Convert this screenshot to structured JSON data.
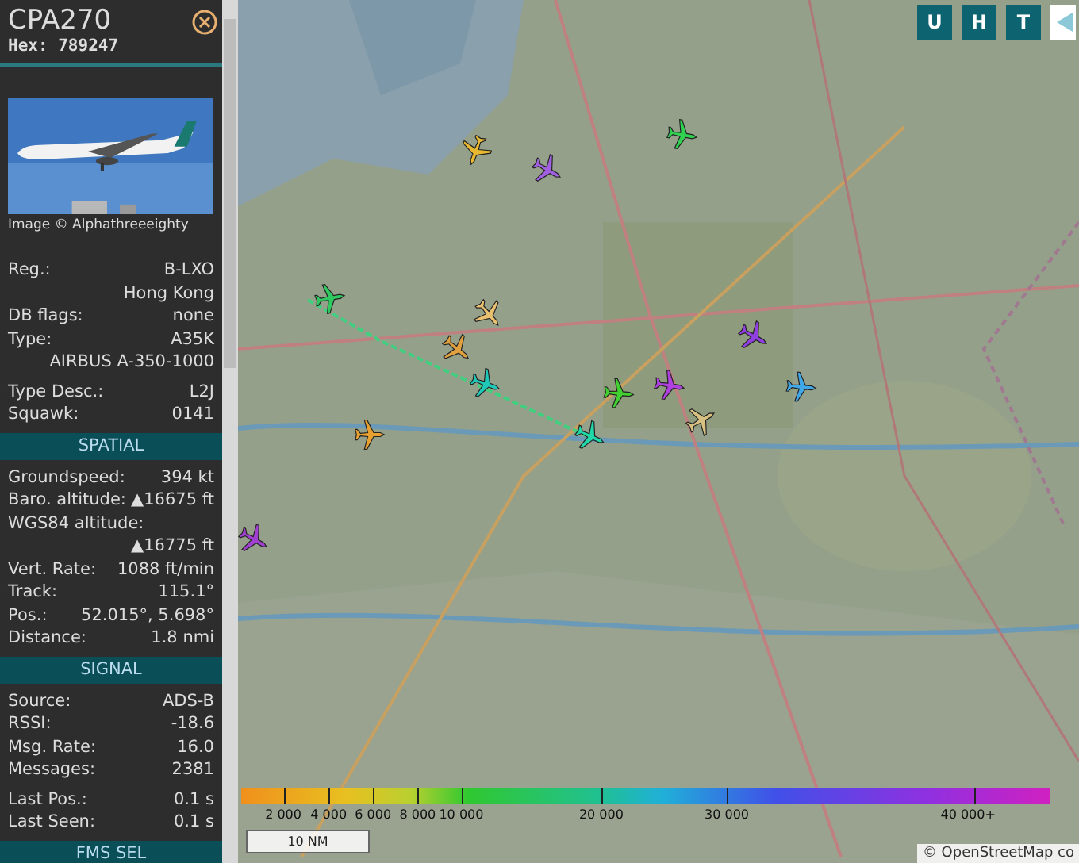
{
  "aircraft_info": {
    "callsign": "CPA270",
    "hex": "Hex: 789247",
    "photo": {
      "kind": "picture",
      "credit": "Image © Alphathreeeighty"
    },
    "groups": [
      {
        "rows": [
          {
            "label": "Reg.:",
            "value": "B-LXO"
          },
          {
            "value": "Hong Kong"
          },
          {
            "label": "DB flags:",
            "value": "none"
          },
          {
            "label": "Type:",
            "value": "A35K"
          },
          {
            "value": "AIRBUS A-350-1000"
          }
        ]
      },
      {
        "rows": [
          {
            "label": "Type Desc.:",
            "value": "L2J"
          },
          {
            "label": "Squawk:",
            "value": "0141"
          }
        ]
      },
      {
        "heading": "SPATIAL",
        "rows": [
          {
            "label": "Groundspeed:",
            "value": "394 kt"
          },
          {
            "label": "Baro. altitude:",
            "value": "▲16675 ft"
          },
          {
            "label": "WGS84 altitude:"
          },
          {
            "value": "▲16775 ft"
          },
          {
            "label": "Vert. Rate:",
            "value": "1088 ft/min"
          },
          {
            "label": "Track:",
            "value": "115.1°"
          },
          {
            "label": "Pos.:",
            "value": "52.015°, 5.698°"
          },
          {
            "label": "Distance:",
            "value": "1.8 nmi"
          }
        ]
      },
      {
        "heading": "SIGNAL",
        "rows": [
          {
            "label": "Source:",
            "value": "ADS-B"
          },
          {
            "label": "RSSI:",
            "value": "-18.6"
          },
          {
            "label": "Msg. Rate:",
            "value": "16.0"
          },
          {
            "label": "Messages:",
            "value": "2381"
          }
        ]
      },
      {
        "rows": [
          {
            "label": "Last Pos.:",
            "value": "0.1 s"
          },
          {
            "label": "Last Seen:",
            "value": "0.1 s"
          }
        ]
      },
      {
        "heading": "FMS SEL"
      }
    ]
  },
  "map": {
    "kind": "picture",
    "buttons": [
      "U",
      "H",
      "T"
    ],
    "aircraft": [
      {
        "color": "#e8b830"
      },
      {
        "color": "#a060e0"
      },
      {
        "color": "#30d050"
      },
      {
        "color": "#30c860"
      },
      {
        "color": "#e0a040"
      },
      {
        "color": "#e8c070"
      },
      {
        "color": "#20c8b8"
      },
      {
        "color": "#40d030"
      },
      {
        "color": "#b040e0"
      },
      {
        "color": "#d8c080"
      },
      {
        "color": "#9040e0"
      },
      {
        "color": "#40a8e8"
      },
      {
        "color": "#20d8a8"
      },
      {
        "color": "#e8a030"
      },
      {
        "color": "#a040d0"
      }
    ],
    "legend": [
      "2 000",
      "4 000",
      "6 000",
      "8 000",
      "10 000",
      "20 000",
      "30 000",
      "40 000+"
    ],
    "scale": "10 NM",
    "attribution": "© OpenStreetMap co"
  }
}
